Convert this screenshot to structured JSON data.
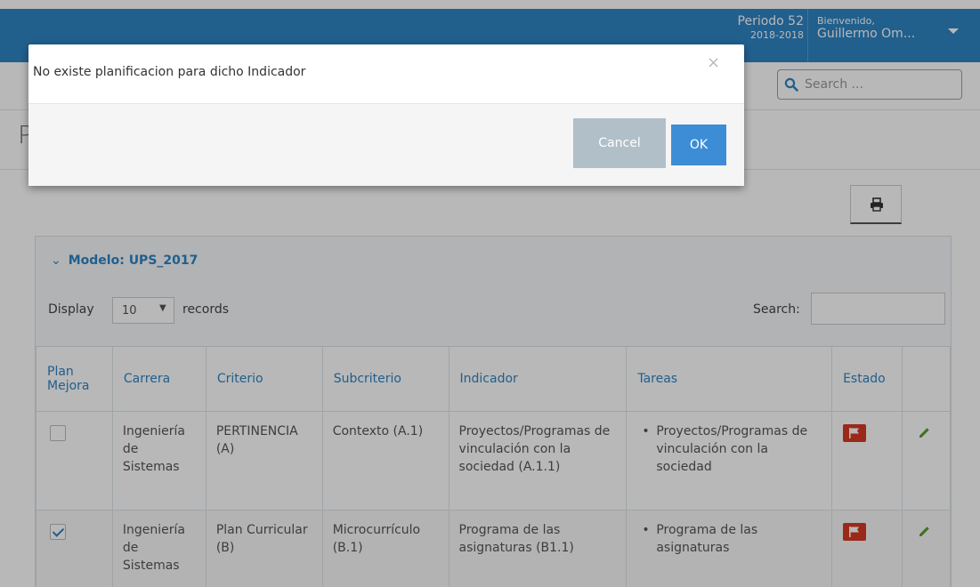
{
  "header": {
    "periodo_label": "Periodo 52",
    "periodo_range": "2018-2018",
    "welcome": "Bienvenido,",
    "user_name": "Guillermo Om..."
  },
  "topbar": {
    "search_placeholder": "Search ..."
  },
  "page": {
    "title_partial": "P"
  },
  "panel": {
    "title": "Modelo: UPS_2017",
    "display_label": "Display",
    "page_length": "10",
    "records_label": "records",
    "search_label": "Search:"
  },
  "table": {
    "columns": [
      "Plan Mejora",
      "Carrera",
      "Criterio",
      "Subcriterio",
      "Indicador",
      "Tareas",
      "Estado",
      ""
    ],
    "rows": [
      {
        "plan_mejora": false,
        "carrera": "Ingeniería de Sistemas",
        "criterio": "PERTINENCIA (A)",
        "subcriterio": "Contexto (A.1)",
        "indicador": "Proyectos/Programas de vinculación con la sociedad (A.1.1)",
        "tarea": "Proyectos/Programas de vinculación con la sociedad",
        "estado_icon": "flag-icon",
        "action_icon": "pencil-icon"
      },
      {
        "plan_mejora": true,
        "carrera": "Ingeniería de Sistemas",
        "criterio": "Plan Curricular (B)",
        "subcriterio": "Microcurrículo (B.1)",
        "indicador": "Programa de las asignaturas (B1.1)",
        "tarea": "Programa de las asignaturas",
        "estado_icon": "flag-icon",
        "action_icon": "pencil-icon"
      }
    ]
  },
  "modal": {
    "message": "No existe planificacion para dicho Indicador",
    "close_glyph": "×",
    "cancel_label": "Cancel",
    "ok_label": "OK"
  },
  "colors": {
    "header": "#2e84c4",
    "link": "#2e84c4",
    "flag": "#d73925",
    "pencil": "#5aa02c",
    "cancel_button": "#b1bfc9",
    "ok_button": "#3c8dd6"
  }
}
